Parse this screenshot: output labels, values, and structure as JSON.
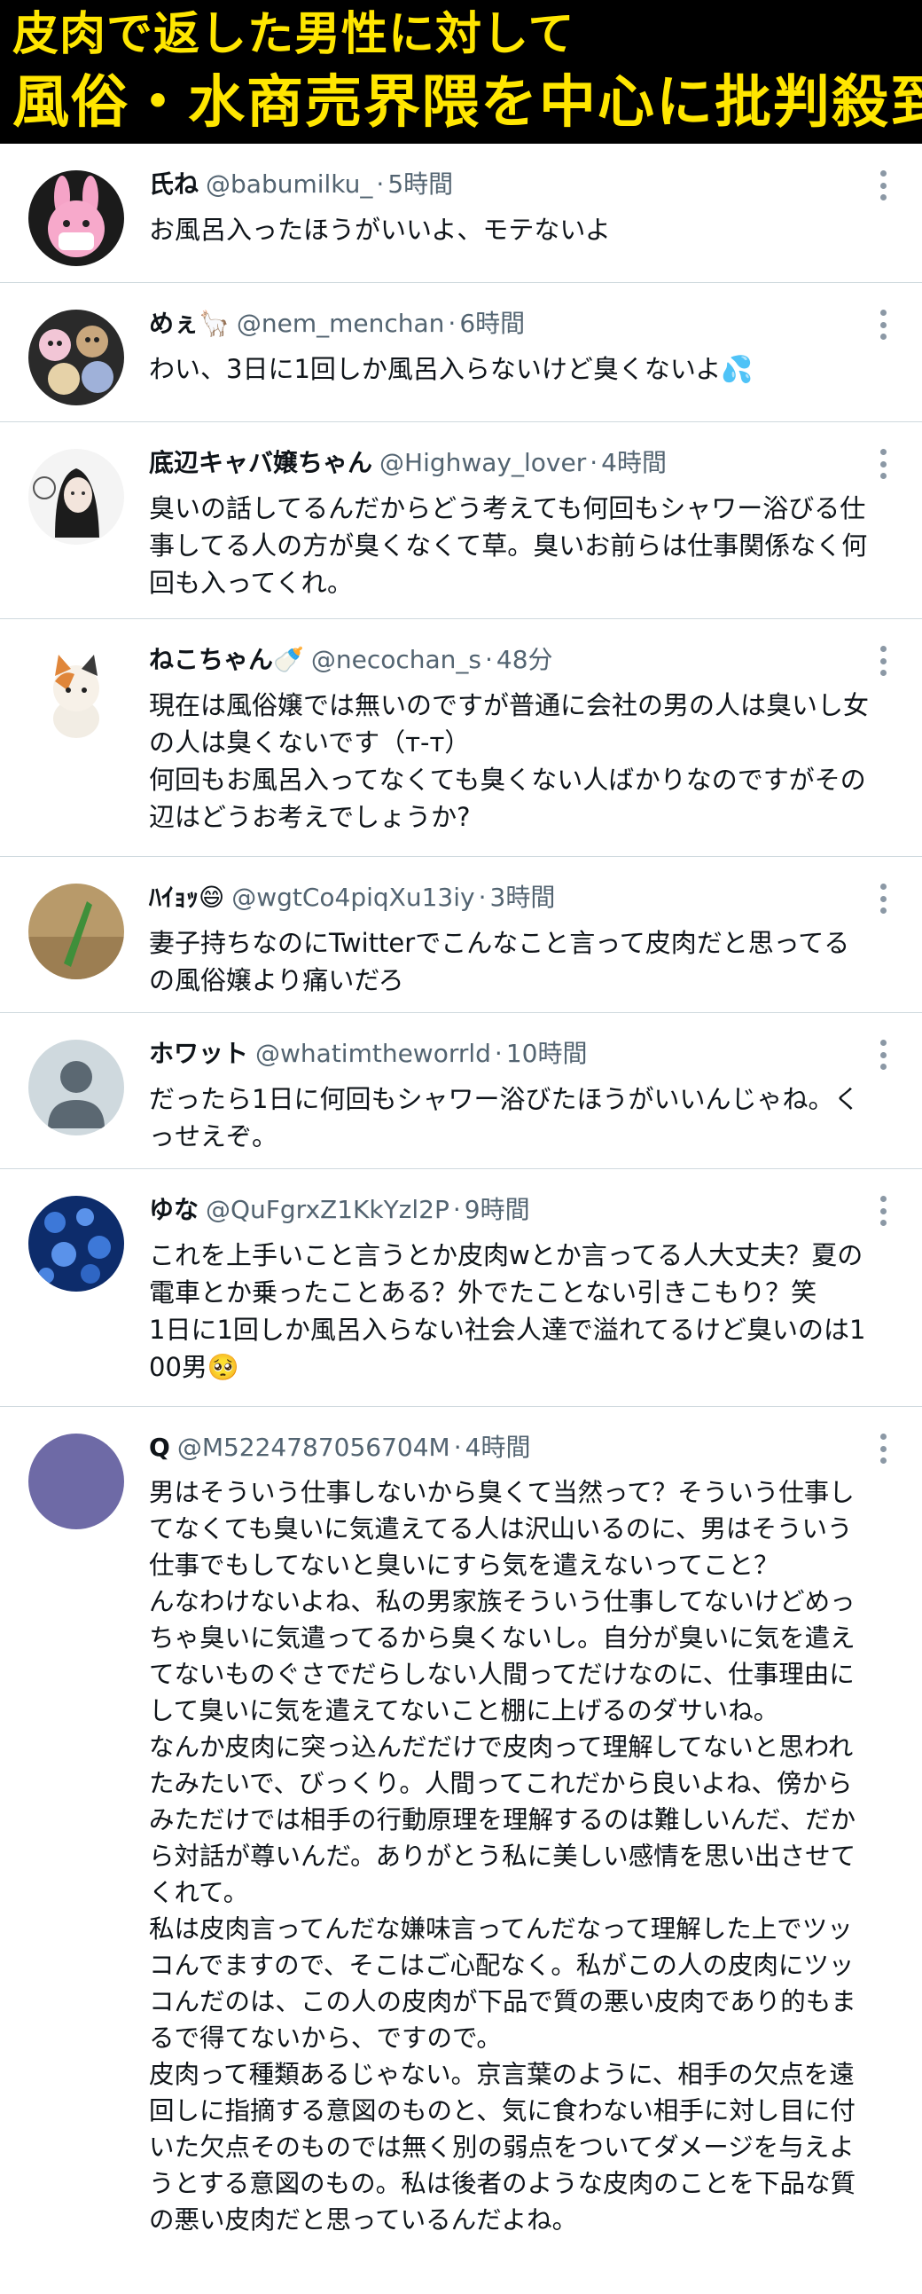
{
  "banner": {
    "line1": "皮肉で返した男性に対して",
    "line2": "風俗・水商売界隈を中心に批判殺到"
  },
  "tweets": [
    {
      "name": "氏ね",
      "handle": "@babumilku_",
      "time": "5時間",
      "text": "お風呂入ったほうがいいよ、モテないよ",
      "avatar_icon": "pink-bunny-mask-avatar"
    },
    {
      "name": "めぇ🦙",
      "handle": "@nem_menchan",
      "time": "6時間",
      "text": "わい、3日に1回しか風呂入らないけど臭くないよ💦",
      "avatar_icon": "cartoon-group-avatar"
    },
    {
      "name": "底辺キャバ嬢ちゃん",
      "handle": "@Highway_lover",
      "time": "4時間",
      "text": "臭いの話してるんだからどう考えても何回もシャワー浴びる仕事してる人の方が臭くなくて草。臭いお前らは仕事関係なく何回も入ってくれ。",
      "avatar_icon": "sketch-girl-avatar"
    },
    {
      "name": "ねこちゃん🍼",
      "handle": "@necochan_s",
      "time": "48分",
      "text": "現在は風俗嬢では無いのですが普通に会社の男の人は臭いし女の人は臭くないです（ᴛ-ᴛ）\n何回もお風呂入ってなくても臭くない人ばかりなのですがその辺はどうお考えでしょうか?",
      "avatar_icon": "calico-cat-avatar"
    },
    {
      "name": "ﾊｲｮｯ😄",
      "handle": "@wgtCo4piqXu13iy",
      "time": "3時間",
      "text": "妻子持ちなのにTwitterでこんなこと言って皮肉だと思ってるの風俗嬢より痛いだろ",
      "avatar_icon": "green-object-avatar"
    },
    {
      "name": "ホワット",
      "handle": "@whatimtheworrld",
      "time": "10時間",
      "text": "だったら1日に何回もシャワー浴びたほうがいいんじゃね。くっせえぞ。",
      "avatar_icon": "default-person-avatar"
    },
    {
      "name": "ゆな",
      "handle": "@QuFgrxZ1KkYzl2P",
      "time": "9時間",
      "text": "これを上手いこと言うとか皮肉wとか言ってる人大丈夫？夏の電車とか乗ったことある？外でたことない引きこもり？笑\n1日に1回しか風呂入らない社会人達で溢れてるけど臭いのは100男🥺",
      "avatar_icon": "blue-flowers-avatar"
    },
    {
      "name": "Q",
      "handle": "@M5224787056704M",
      "time": "4時間",
      "text": "男はそういう仕事しないから臭くて当然って？そういう仕事してなくても臭いに気遣えてる人は沢山いるのに、男はそういう仕事でもしてないと臭いにすら気を遣えないってこと？\nんなわけないよね、私の男家族そういう仕事してないけどめっちゃ臭いに気遣ってるから臭くないし。自分が臭いに気を遣えてないものぐさでだらしない人間ってだけなのに、仕事理由にして臭いに気を遣えてないこと棚に上げるのダサいね。\nなんか皮肉に突っ込んだだけで皮肉って理解してないと思われたみたいで、びっくり。人間ってこれだから良いよね、傍からみただけでは相手の行動原理を理解するのは難しいんだ、だから対話が尊いんだ。ありがとう私に美しい感情を思い出させてくれて。\n私は皮肉言ってんだな嫌味言ってんだなって理解した上でツッコんでますので、そこはご心配なく。私がこの人の皮肉にツッコんだのは、この人の皮肉が下品で質の悪い皮肉であり的もまるで得てないから、ですので。\n皮肉って種類あるじゃない。京言葉のように、相手の欠点を遠回しに指摘する意図のものと、気に食わない相手に対し目に付いた欠点そのものでは無く別の弱点をついてダメージを与えようとする意図のもの。私は後者のような皮肉のことを下品な質の悪い皮肉だと思っているんだよね。",
      "avatar_icon": "purple-circle-avatar"
    }
  ],
  "ui": {
    "separator": "·",
    "more_icon": "more-vertical-icon",
    "accent": "#ffe600",
    "muted": "#536471"
  }
}
